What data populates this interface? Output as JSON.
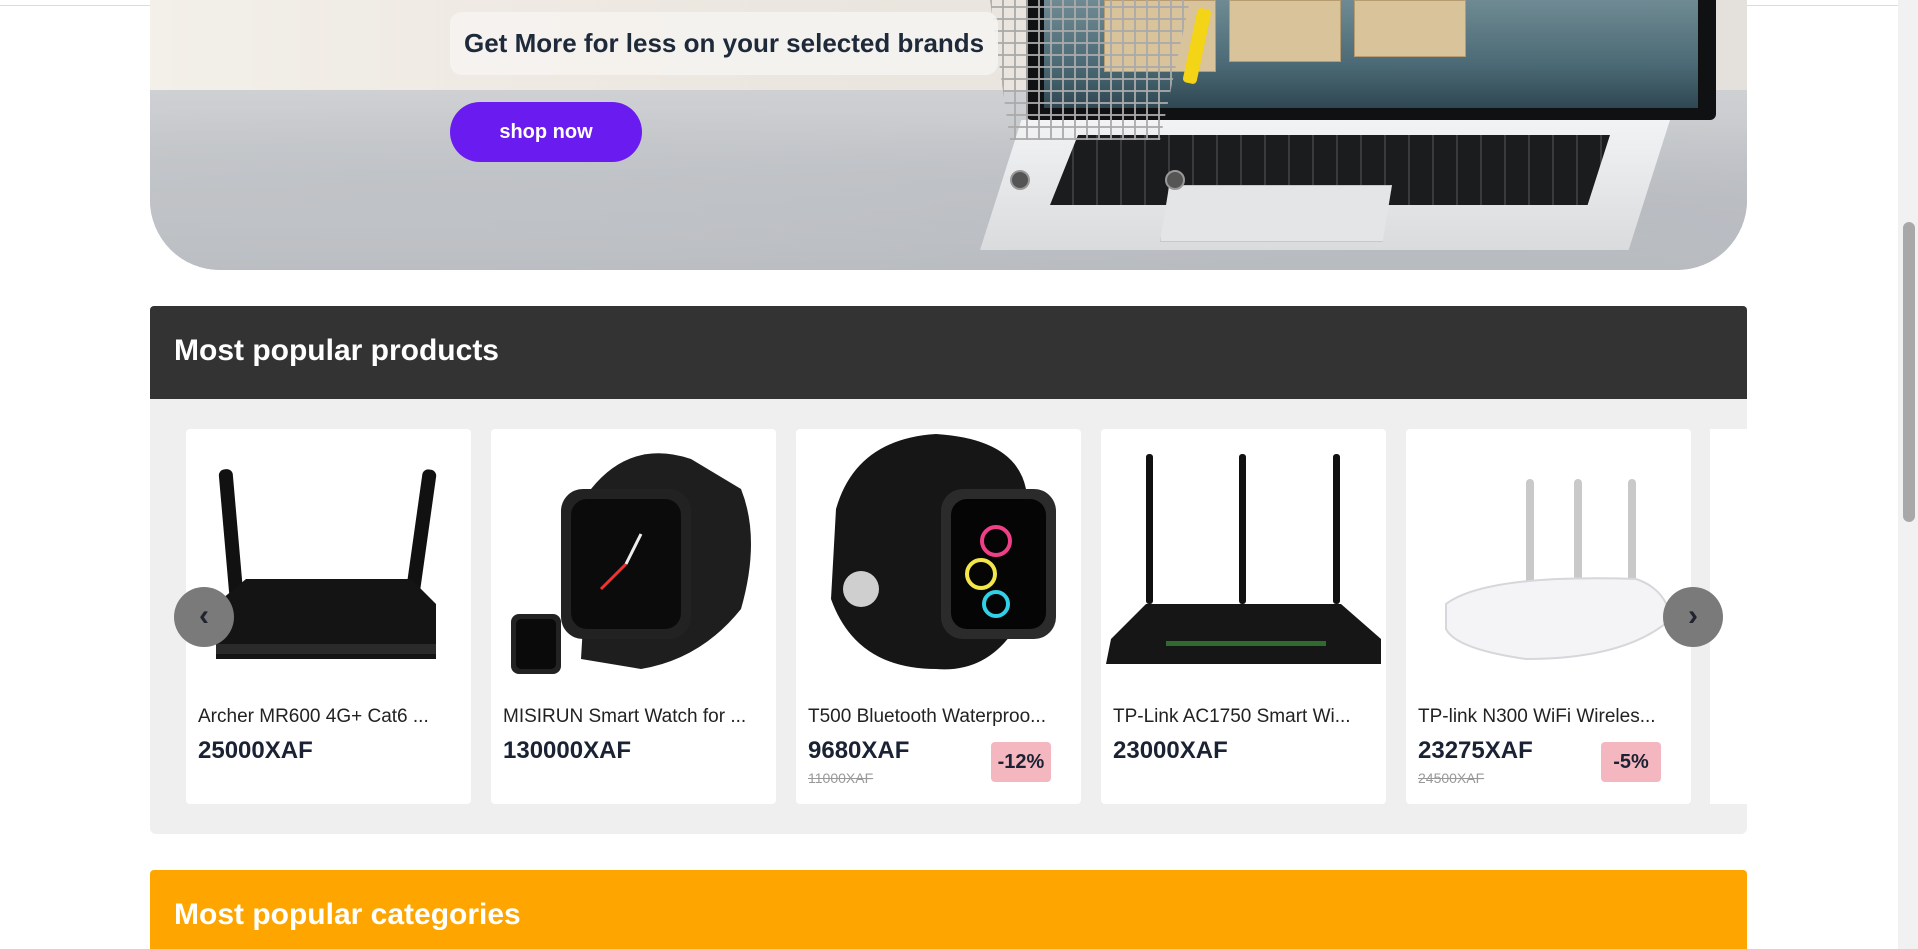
{
  "hero": {
    "title": "Get More for less on your selected brands",
    "button_label": "shop now"
  },
  "popular_products": {
    "title": "Most popular products",
    "prev_icon": "chevron-left-icon",
    "next_icon": "chevron-right-icon",
    "prev_glyph": "‹",
    "next_glyph": "›",
    "items": [
      {
        "name": "Archer MR600 4G+ Cat6 ...",
        "price": "25000XAF",
        "old_price": "",
        "discount": "",
        "image": "router-icon"
      },
      {
        "name": "MISIRUN Smart Watch for ...",
        "price": "130000XAF",
        "old_price": "",
        "discount": "",
        "image": "smartwatch-icon"
      },
      {
        "name": "T500 Bluetooth Waterproo...",
        "price": "9680XAF",
        "old_price": "11000XAF",
        "discount": "-12%",
        "image": "smartwatch-icon"
      },
      {
        "name": "TP-Link AC1750 Smart Wi...",
        "price": "23000XAF",
        "old_price": "",
        "discount": "",
        "image": "router-icon"
      },
      {
        "name": "TP-link N300 WiFi Wireles...",
        "price": "23275XAF",
        "old_price": "24500XAF",
        "discount": "-5%",
        "image": "router-icon"
      }
    ]
  },
  "popular_categories": {
    "title": "Most popular categories"
  },
  "colors": {
    "accent_purple": "#6a1cf0",
    "header_dark": "#333333",
    "categories_orange": "#ffa500",
    "discount_badge": "#f4b6bf"
  }
}
